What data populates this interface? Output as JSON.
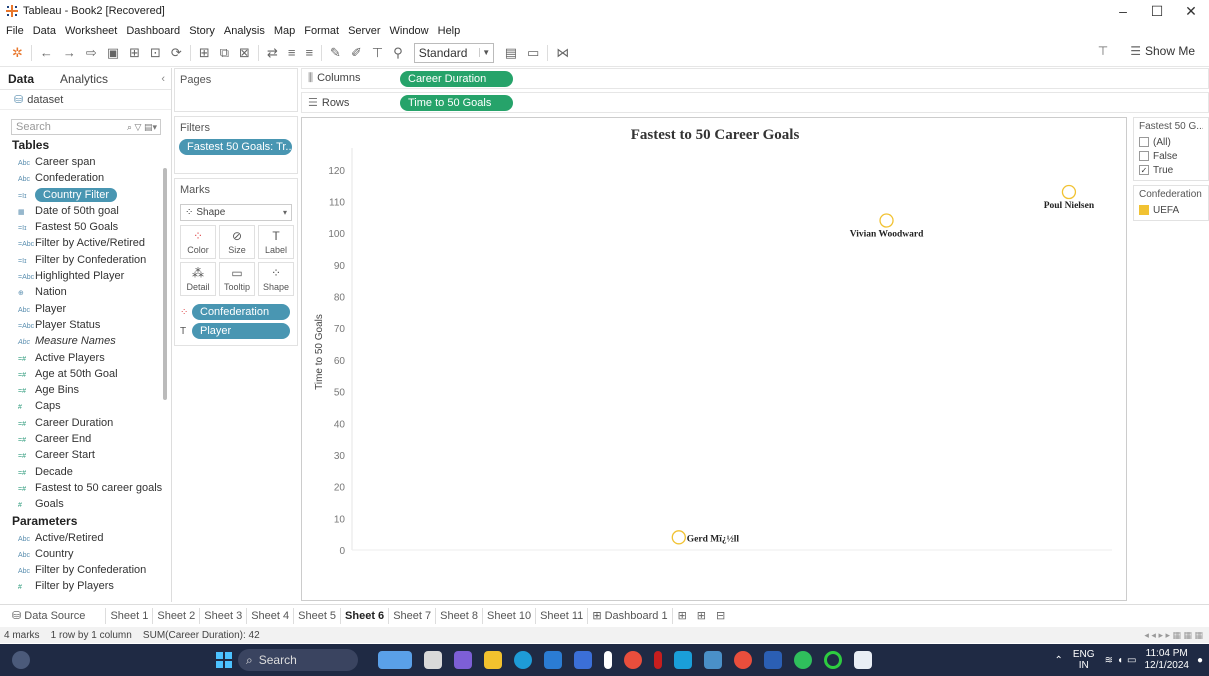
{
  "window": {
    "title": "Tableau - Book2 [Recovered]",
    "controls": [
      "–",
      "☐",
      "✕"
    ]
  },
  "menu": [
    "File",
    "Data",
    "Worksheet",
    "Dashboard",
    "Story",
    "Analysis",
    "Map",
    "Format",
    "Server",
    "Window",
    "Help"
  ],
  "toolbar": {
    "fit_select": "Standard",
    "show_me_label": "Show Me"
  },
  "data_pane": {
    "tabs": [
      "Data",
      "Analytics"
    ],
    "source": "dataset",
    "search_placeholder": "Search",
    "tables_heading": "Tables",
    "fields": [
      {
        "type": "Abc",
        "name": "Career span"
      },
      {
        "type": "Abc",
        "name": "Confederation"
      },
      {
        "type": "=Iɪ",
        "name": "Country Filter",
        "selected": true
      },
      {
        "type": "▦",
        "name": "Date of 50th goal"
      },
      {
        "type": "=Iɪ",
        "name": "Fastest 50 Goals"
      },
      {
        "type": "=Abc",
        "name": "Filter by Active/Retired"
      },
      {
        "type": "=Iɪ",
        "name": "Filter by Confederation"
      },
      {
        "type": "=Abc",
        "name": "Highlighted Player"
      },
      {
        "type": "⊕",
        "name": "Nation"
      },
      {
        "type": "Abc",
        "name": "Player"
      },
      {
        "type": "=Abc",
        "name": "Player Status"
      },
      {
        "type": "Abc",
        "name": "Measure Names",
        "italic": true
      },
      {
        "type": "=#",
        "name": "Active Players",
        "measure": true
      },
      {
        "type": "=#",
        "name": "Age at 50th Goal",
        "measure": true
      },
      {
        "type": "=#",
        "name": "Age Bins",
        "measure": true
      },
      {
        "type": "#",
        "name": "Caps",
        "measure": true
      },
      {
        "type": "=#",
        "name": "Career Duration",
        "measure": true
      },
      {
        "type": "=#",
        "name": "Career End",
        "measure": true
      },
      {
        "type": "=#",
        "name": "Career Start",
        "measure": true
      },
      {
        "type": "=#",
        "name": "Decade",
        "measure": true
      },
      {
        "type": "=#",
        "name": "Fastest to 50 career goals",
        "measure": true
      },
      {
        "type": "#",
        "name": "Goals",
        "measure": true
      }
    ],
    "parameters_heading": "Parameters",
    "parameters": [
      {
        "type": "Abc",
        "name": "Active/Retired"
      },
      {
        "type": "Abc",
        "name": "Country"
      },
      {
        "type": "Abc",
        "name": "Filter by Confederation"
      },
      {
        "type": "#",
        "name": "Filter by Players",
        "measure": true
      }
    ]
  },
  "shelves": {
    "pages_label": "Pages",
    "filters_label": "Filters",
    "filter_pill": "Fastest 50 Goals: Tr..",
    "marks_label": "Marks",
    "mark_type": "Shape",
    "mark_buttons": [
      {
        "icon": "⁘",
        "label": "Color"
      },
      {
        "icon": "⊘",
        "label": "Size"
      },
      {
        "icon": "T",
        "label": "Label"
      },
      {
        "icon": "⁂",
        "label": "Detail"
      },
      {
        "icon": "▭",
        "label": "Tooltip"
      },
      {
        "icon": "⁘",
        "label": "Shape"
      }
    ],
    "mark_pills": [
      "Confederation",
      "Player"
    ],
    "columns_label": "Columns",
    "columns_pill": "Career Duration",
    "rows_label": "Rows",
    "rows_pill": "Time to 50 Goals"
  },
  "chart_data": {
    "type": "scatter",
    "title": "Fastest to 50 Career Goals",
    "xlabel": "",
    "ylabel": "Time to 50 Goals",
    "y_ticks": [
      0,
      10,
      20,
      30,
      40,
      50,
      60,
      70,
      80,
      90,
      100,
      110,
      120
    ],
    "ylim": [
      0,
      125
    ],
    "xlim": [
      0,
      30
    ],
    "points": [
      {
        "label": "Poul Nielsen",
        "x": 28.3,
        "y": 113
      },
      {
        "label": "Vivian Woodward",
        "x": 21.1,
        "y": 104
      },
      {
        "label": "Gerd Mï¿½ll",
        "x": 12.9,
        "y": 4
      },
      {
        "label": "",
        "x": 0,
        "y": 0
      }
    ],
    "marker_color": "#f1c232"
  },
  "legends": {
    "filter_title": "Fastest 50 G...",
    "filter_items": [
      {
        "label": "(All)",
        "checked": false
      },
      {
        "label": "False",
        "checked": false
      },
      {
        "label": "True",
        "checked": true
      }
    ],
    "color_title": "Confederation",
    "color_items": [
      {
        "label": "UEFA",
        "color": "#f1c232"
      }
    ]
  },
  "sheet_tabs": {
    "data_source": "Data Source",
    "sheets": [
      "Sheet 1",
      "Sheet 2",
      "Sheet 3",
      "Sheet 4",
      "Sheet 5",
      "Sheet 6",
      "Sheet 7",
      "Sheet 8",
      "Sheet 10",
      "Sheet 11",
      "⊞ Dashboard 1"
    ],
    "active": "Sheet 6"
  },
  "status": "4 marks    1 row by 1 column    SUM(Career Duration): 42",
  "taskbar": {
    "search_label": "Search",
    "lang": "ENG",
    "region": "IN",
    "time": "11:04 PM",
    "date": "12/1/2024"
  }
}
